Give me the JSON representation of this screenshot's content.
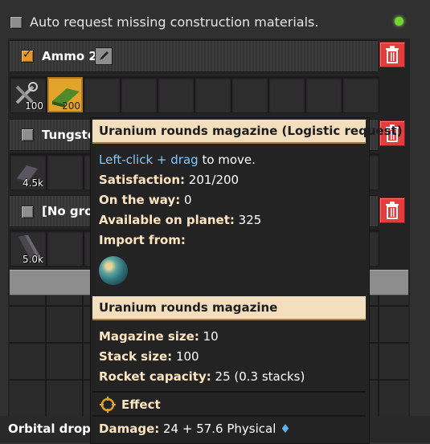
{
  "auto_request": {
    "label": "Auto request missing construction materials."
  },
  "sections": [
    {
      "title": "Ammo 2",
      "slots": [
        {
          "count": "100"
        },
        {
          "count": "200"
        }
      ]
    },
    {
      "title": "Tungste",
      "slots": [
        {
          "count": "4.5k"
        }
      ]
    },
    {
      "title": "[No grou",
      "slots": [
        {
          "count": "5.0k"
        }
      ]
    }
  ],
  "footer": {
    "text": "Orbital drop sl"
  },
  "tooltip": {
    "title": "Uranium rounds magazine (Logistic request)",
    "hint_action": "Left-click + drag",
    "hint_rest": "to move.",
    "satisfaction_label": "Satisfaction:",
    "satisfaction_value": "201/200",
    "on_the_way_label": "On the way:",
    "on_the_way_value": "0",
    "available_label": "Available on planet:",
    "available_value": "325",
    "import_label": "Import from:",
    "item_title": "Uranium rounds magazine",
    "magazine_label": "Magazine size:",
    "magazine_value": "10",
    "stack_label": "Stack size:",
    "stack_value": "100",
    "rocket_label": "Rocket capacity:",
    "rocket_value": "25 (0.3 stacks)",
    "effect_label": "Effect",
    "damage_label": "Damage:",
    "damage_value": "24 + 57.6 Physical"
  },
  "colors": {
    "accent_orange": "#e3a42b",
    "trash_red": "#e23c3c",
    "header_cream": "#f3dfbe",
    "link_blue": "#7ec8ff",
    "status_green": "#6fd62c"
  }
}
